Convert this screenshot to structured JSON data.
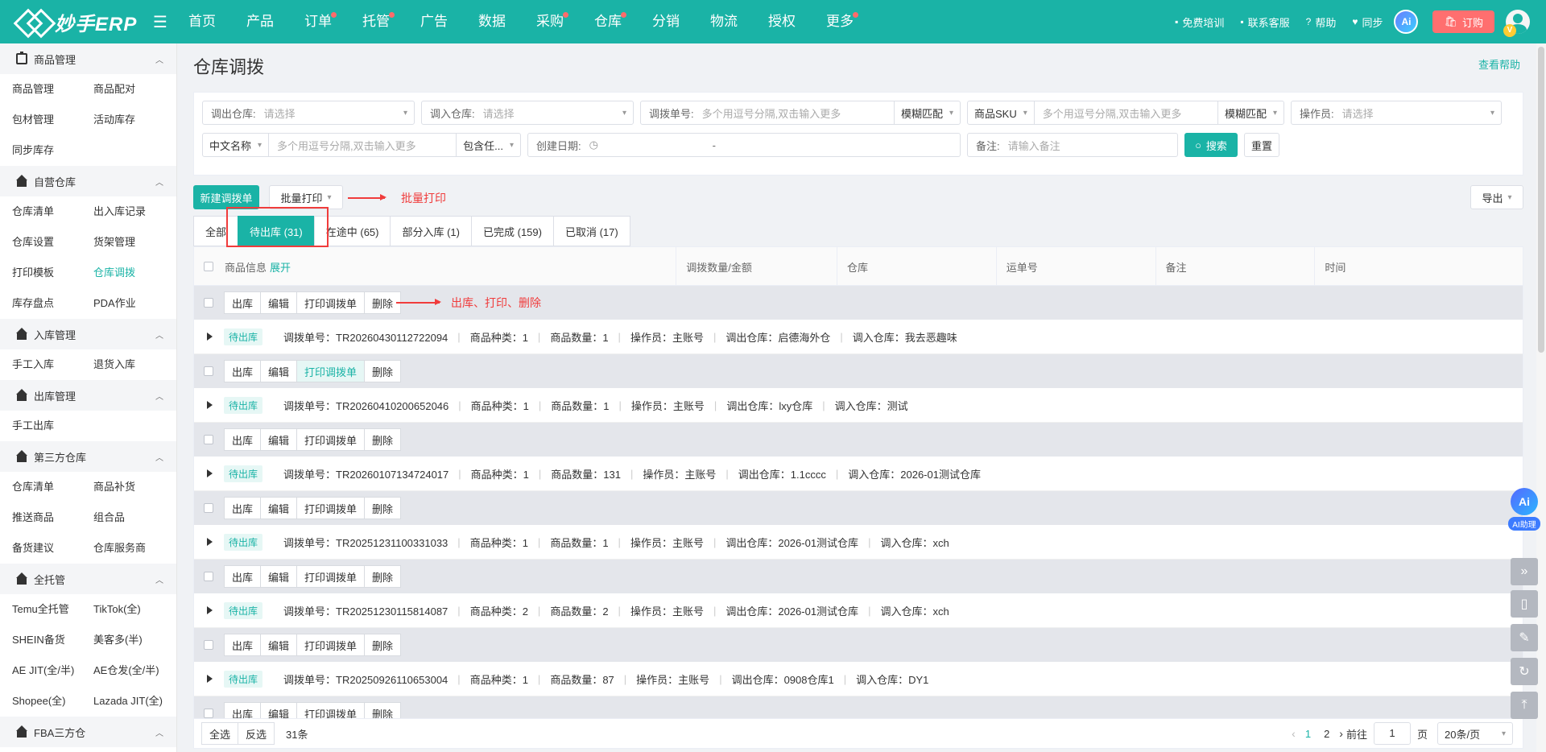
{
  "header": {
    "logo_text": "妙手ERP",
    "nav": [
      {
        "label": "首页",
        "dot": false
      },
      {
        "label": "产品",
        "dot": false
      },
      {
        "label": "订单",
        "dot": true
      },
      {
        "label": "托管",
        "dot": true
      },
      {
        "label": "广告",
        "dot": false
      },
      {
        "label": "数据",
        "dot": false
      },
      {
        "label": "采购",
        "dot": true
      },
      {
        "label": "仓库",
        "dot": true
      },
      {
        "label": "分销",
        "dot": false
      },
      {
        "label": "物流",
        "dot": false
      },
      {
        "label": "授权",
        "dot": false
      },
      {
        "label": "更多",
        "dot": true
      }
    ],
    "links": [
      {
        "label": "免费培训",
        "icon": "training-icon"
      },
      {
        "label": "联系客服",
        "icon": "chat-icon"
      },
      {
        "label": "帮助",
        "icon": "help-icon"
      },
      {
        "label": "同步",
        "icon": "sync-icon"
      }
    ],
    "ai_label": "Ai",
    "order_label": "订购",
    "vip_label": "V"
  },
  "sidebar": {
    "sections": [
      {
        "title": "商品管理",
        "icon": "clipboard-icon",
        "items": [
          "商品管理",
          "商品配对",
          "包材管理",
          "活动库存",
          "同步库存"
        ]
      },
      {
        "title": "自营仓库",
        "icon": "house-icon",
        "items": [
          "仓库清单",
          "出入库记录",
          "仓库设置",
          "货架管理",
          "打印模板",
          "仓库调拨",
          "库存盘点",
          "PDA作业"
        ]
      },
      {
        "title": "入库管理",
        "icon": "house-icon",
        "items": [
          "手工入库",
          "退货入库"
        ]
      },
      {
        "title": "出库管理",
        "icon": "house-icon",
        "items": [
          "手工出库"
        ]
      },
      {
        "title": "第三方仓库",
        "icon": "house-icon",
        "items": [
          "仓库清单",
          "商品补货",
          "推送商品",
          "组合品",
          "备货建议",
          "仓库服务商"
        ]
      },
      {
        "title": "全托管",
        "icon": "house-icon",
        "items": [
          "Temu全托管",
          "TikTok(全)",
          "SHEIN备货",
          "美客多(半)",
          "AE JIT(全/半)",
          "AE仓发(全/半)",
          "Shopee(全)",
          "Lazada JIT(全)"
        ]
      },
      {
        "title": "FBA三方仓",
        "icon": "house-icon",
        "items": []
      }
    ],
    "active_item": "仓库调拨"
  },
  "page": {
    "title": "仓库调拨",
    "help": "查看帮助"
  },
  "filters": {
    "out_warehouse": {
      "label": "调出仓库:",
      "placeholder": "请选择"
    },
    "in_warehouse": {
      "label": "调入仓库:",
      "placeholder": "请选择"
    },
    "transfer_no": {
      "label": "调拨单号:",
      "placeholder": "多个用逗号分隔,双击输入更多",
      "match": "模糊匹配"
    },
    "sku": {
      "label": "商品SKU",
      "placeholder": "多个用逗号分隔,双击输入更多",
      "match": "模糊匹配"
    },
    "operator": {
      "label": "操作员:",
      "placeholder": "请选择"
    },
    "cn_name": {
      "label": "中文名称",
      "placeholder": "多个用逗号分隔,双击输入更多",
      "mode": "包含任..."
    },
    "created": {
      "label": "创建日期:",
      "sep": "-"
    },
    "remark": {
      "label": "备注:",
      "placeholder": "请输入备注"
    },
    "search_btn": "搜索",
    "reset_btn": "重置"
  },
  "toolbar": {
    "new_btn": "新建调拨单",
    "batch_print": "批量打印",
    "export": "导出",
    "annotation_batch": "批量打印",
    "annotation_actions": "出库、打印、删除"
  },
  "tabs": [
    {
      "label": "全部",
      "active": false
    },
    {
      "label": "待出库 (31)",
      "active": true
    },
    {
      "label": "在途中 (65)",
      "active": false
    },
    {
      "label": "部分入库 (1)",
      "active": false
    },
    {
      "label": "已完成 (159)",
      "active": false
    },
    {
      "label": "已取消 (17)",
      "active": false
    }
  ],
  "table": {
    "headers": [
      "商品信息",
      "调拨数量/金额",
      "仓库",
      "运单号",
      "备注",
      "时间"
    ],
    "expand_label": "展开",
    "actions": [
      "出库",
      "编辑",
      "打印调拨单",
      "删除"
    ],
    "rows": [
      {
        "status": "待出库",
        "no": "调拨单号：TR20260430112722094",
        "kinds": "商品种类：1",
        "qty": "商品数量：1",
        "operator": "操作员：主账号",
        "out": "调出仓库：启德海外仓",
        "in": "调入仓库：我去恶趣味"
      },
      {
        "status": "待出库",
        "no": "调拨单号：TR20260410200652046",
        "kinds": "商品种类：1",
        "qty": "商品数量：1",
        "operator": "操作员：主账号",
        "out": "调出仓库：lxy仓库",
        "in": "调入仓库：测试"
      },
      {
        "status": "待出库",
        "no": "调拨单号：TR20260107134724017",
        "kinds": "商品种类：1",
        "qty": "商品数量：131",
        "operator": "操作员：主账号",
        "out": "调出仓库：1.1cccc",
        "in": "调入仓库：2026-01测试仓库"
      },
      {
        "status": "待出库",
        "no": "调拨单号：TR20251231100331033",
        "kinds": "商品种类：1",
        "qty": "商品数量：1",
        "operator": "操作员：主账号",
        "out": "调出仓库：2026-01测试仓库",
        "in": "调入仓库：xch"
      },
      {
        "status": "待出库",
        "no": "调拨单号：TR20251230115814087",
        "kinds": "商品种类：2",
        "qty": "商品数量：2",
        "operator": "操作员：主账号",
        "out": "调出仓库：2026-01测试仓库",
        "in": "调入仓库：xch"
      },
      {
        "status": "待出库",
        "no": "调拨单号：TR20250926110653004",
        "kinds": "商品种类：1",
        "qty": "商品数量：87",
        "operator": "操作员：主账号",
        "out": "调出仓库：0908仓库1",
        "in": "调入仓库：DY1"
      }
    ]
  },
  "footer": {
    "select_all": "全选",
    "invert": "反选",
    "total": "31条",
    "pages": [
      "1",
      "2"
    ],
    "goto_label": "前往",
    "goto_value": "1",
    "page_unit": "页",
    "page_size": "20条/页"
  },
  "float": {
    "ai_label": "AI助理"
  }
}
